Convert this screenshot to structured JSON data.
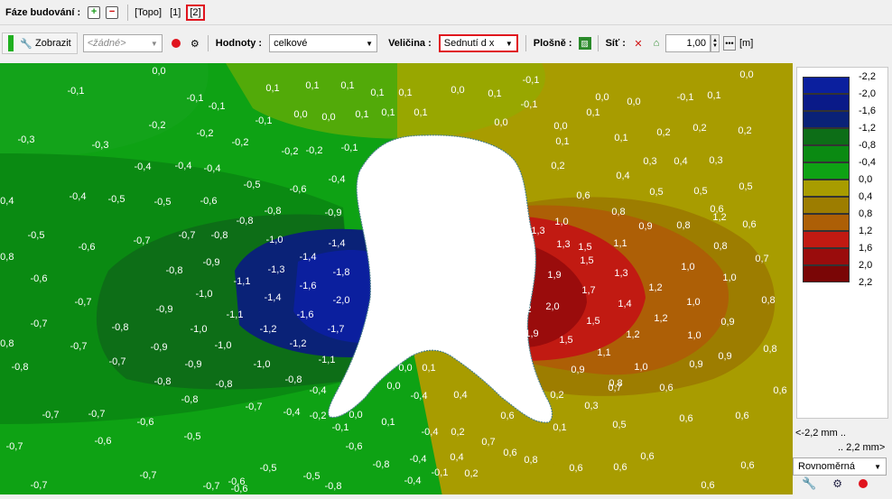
{
  "phase_bar": {
    "label": "Fáze budování :",
    "phases": [
      "[Topo]",
      "[1]",
      "[2]"
    ],
    "selected_index": 2
  },
  "toolbar": {
    "show_label": "Zobrazit",
    "none_combo": "<žádné>",
    "values_label": "Hodnoty :",
    "values_combo": "celkové",
    "quantity_label": "Veličina :",
    "quantity_combo": "Sednutí d x",
    "area_label": "Plošně :",
    "grid_label": "Síť :",
    "grid_value": "1,00",
    "grid_unit": "[m]"
  },
  "legend": {
    "colors": [
      "#0b1f9e",
      "#0a1a88",
      "#0a2277",
      "#0d6e17",
      "#0a8a12",
      "#0ea214",
      "#a89c00",
      "#9d7d00",
      "#ad5f06",
      "#c11a12",
      "#9a0c0c",
      "#7a0606"
    ],
    "labels": [
      "-2,2",
      "-2,0",
      "-1,6",
      "-1,2",
      "-0,8",
      "-0,4",
      "0,0",
      "0,4",
      "0,8",
      "1,2",
      "1,6",
      "2,0",
      "2,2"
    ],
    "range_min": "<-2,2 mm ..",
    "range_max": ".. 2,2 mm>",
    "scale_mode": "Rovnoměrná"
  },
  "plot_labels": [
    [
      "0,0",
      176,
      82
    ],
    [
      "-0,1",
      84,
      104
    ],
    [
      "-0,1",
      216,
      112
    ],
    [
      "0,1",
      302,
      101
    ],
    [
      "0,1",
      346,
      98
    ],
    [
      "0,1",
      385,
      98
    ],
    [
      "0,1",
      418,
      106
    ],
    [
      "0,1",
      449,
      106
    ],
    [
      "0,0",
      507,
      103
    ],
    [
      "0,1",
      548,
      107
    ],
    [
      "-0,1",
      588,
      92
    ],
    [
      "0,0",
      667,
      111
    ],
    [
      "0,0",
      702,
      116
    ],
    [
      "-0,1",
      759,
      111
    ],
    [
      "0,0",
      827,
      86
    ],
    [
      "-0,1",
      240,
      121
    ],
    [
      "-0,2",
      174,
      142
    ],
    [
      "-0,1",
      292,
      137
    ],
    [
      "0,0",
      333,
      130
    ],
    [
      "0,0",
      364,
      133
    ],
    [
      "0,1",
      401,
      130
    ],
    [
      "0,1",
      430,
      128
    ],
    [
      "0,1",
      466,
      128
    ],
    [
      "0,0",
      555,
      139
    ],
    [
      "-0,1",
      586,
      119
    ],
    [
      "0,1",
      657,
      128
    ],
    [
      "0,1",
      791,
      109
    ],
    [
      "0,0",
      621,
      143
    ],
    [
      "0,1",
      688,
      156
    ],
    [
      "0,2",
      735,
      150
    ],
    [
      "0,2",
      775,
      145
    ],
    [
      "0,2",
      825,
      148
    ],
    [
      "-0,3",
      29,
      158
    ],
    [
      "-0,3",
      111,
      164
    ],
    [
      "-0,2",
      227,
      151
    ],
    [
      "-0,2",
      266,
      161
    ],
    [
      "-0,2",
      321,
      171
    ],
    [
      "-0,2",
      348,
      170
    ],
    [
      "-0,1",
      387,
      167
    ],
    [
      "0,1",
      623,
      160
    ],
    [
      "-0,4",
      158,
      188
    ],
    [
      "-0,4",
      203,
      187
    ],
    [
      "-0,4",
      235,
      190
    ],
    [
      "0,2",
      618,
      187
    ],
    [
      "0,3",
      720,
      182
    ],
    [
      "0,4",
      754,
      182
    ],
    [
      "0,3",
      793,
      181
    ],
    [
      "-0,5",
      279,
      208
    ],
    [
      "-0,6",
      330,
      213
    ],
    [
      "-0,4",
      373,
      202
    ],
    [
      "0,4",
      690,
      198
    ],
    [
      "0,5",
      727,
      216
    ],
    [
      "0,5",
      776,
      215
    ],
    [
      "0,5",
      826,
      210
    ],
    [
      "-0,4",
      6,
      226
    ],
    [
      "-0,4",
      86,
      221
    ],
    [
      "-0,5",
      129,
      224
    ],
    [
      "-0,5",
      180,
      227
    ],
    [
      "-0,6",
      231,
      226
    ],
    [
      "0,6",
      646,
      220
    ],
    [
      "0,8",
      685,
      238
    ],
    [
      "0,6",
      794,
      235
    ],
    [
      "-0,8",
      302,
      237
    ],
    [
      "-0,9",
      369,
      239
    ],
    [
      "-0,8",
      271,
      248
    ],
    [
      "1,0",
      622,
      249
    ],
    [
      "0,9",
      715,
      254
    ],
    [
      "0,8",
      757,
      253
    ],
    [
      "1,2",
      797,
      244
    ],
    [
      "0,6",
      830,
      252
    ],
    [
      "-0,5",
      40,
      264
    ],
    [
      "-0,6",
      96,
      277
    ],
    [
      "-0,7",
      157,
      270
    ],
    [
      "-0,7",
      207,
      264
    ],
    [
      "-0,8",
      243,
      264
    ],
    [
      "-1,0",
      304,
      269
    ],
    [
      "-1,4",
      373,
      273
    ],
    [
      "1,3",
      596,
      259
    ],
    [
      "1,3",
      624,
      274
    ],
    [
      "1,5",
      648,
      277
    ],
    [
      "1,1",
      687,
      273
    ],
    [
      "0,8",
      798,
      276
    ],
    [
      "-0,8",
      6,
      288
    ],
    [
      "-0,9",
      234,
      294
    ],
    [
      "-1,4",
      341,
      288
    ],
    [
      "-1,8",
      378,
      305
    ],
    [
      "1,5",
      650,
      292
    ],
    [
      "1,0",
      762,
      299
    ],
    [
      "0,7",
      844,
      290
    ],
    [
      "-0,6",
      43,
      312
    ],
    [
      "-0,8",
      193,
      303
    ],
    [
      "-1,3",
      306,
      302
    ],
    [
      "-1,6",
      341,
      320
    ],
    [
      "-2,0",
      378,
      336
    ],
    [
      "1,9",
      614,
      308
    ],
    [
      "1,3",
      688,
      306
    ],
    [
      "1,2",
      726,
      322
    ],
    [
      "1,0",
      808,
      311
    ],
    [
      "-1,1",
      268,
      315
    ],
    [
      "-1,4",
      302,
      333
    ],
    [
      "-1,0",
      226,
      329
    ],
    [
      "-1,6",
      338,
      352
    ],
    [
      "-0,7",
      92,
      338
    ],
    [
      "-0,9",
      182,
      346
    ],
    [
      "2,2",
      583,
      318
    ],
    [
      "1,7",
      652,
      325
    ],
    [
      "1,4",
      692,
      340
    ],
    [
      "1,0",
      768,
      338
    ],
    [
      "0,8",
      851,
      336
    ],
    [
      "-0,8",
      133,
      366
    ],
    [
      "-1,1",
      260,
      352
    ],
    [
      "-1,2",
      297,
      368
    ],
    [
      "-1,7",
      372,
      368
    ],
    [
      "-1,0",
      220,
      368
    ],
    [
      "2,2",
      581,
      346
    ],
    [
      "2,0",
      612,
      343
    ],
    [
      "1,2",
      732,
      356
    ],
    [
      "1,5",
      657,
      359
    ],
    [
      "0,9",
      806,
      360
    ],
    [
      "-0,7",
      43,
      362
    ],
    [
      "-0,7",
      87,
      387
    ],
    [
      "-0,9",
      176,
      388
    ],
    [
      "-1,0",
      247,
      386
    ],
    [
      "-1,2",
      330,
      384
    ],
    [
      "1,9",
      589,
      373
    ],
    [
      "1,5",
      627,
      380
    ],
    [
      "1,2",
      701,
      374
    ],
    [
      "1,0",
      769,
      375
    ],
    [
      "0,8",
      853,
      390
    ],
    [
      "-0,8",
      6,
      384
    ],
    [
      "-0,8",
      22,
      410
    ],
    [
      "-0,7",
      130,
      404
    ],
    [
      "-0,9",
      214,
      407
    ],
    [
      "-1,0",
      290,
      407
    ],
    [
      "-1,1",
      362,
      402
    ],
    [
      "1,1",
      669,
      394
    ],
    [
      "1,0",
      710,
      410
    ],
    [
      "0,9",
      771,
      407
    ],
    [
      "0,9",
      803,
      398
    ],
    [
      "0,9",
      640,
      413
    ],
    [
      "0,8",
      682,
      428
    ],
    [
      "-0,8",
      180,
      426
    ],
    [
      "-0,8",
      248,
      429
    ],
    [
      "-0,8",
      325,
      424
    ],
    [
      "0,0",
      449,
      411
    ],
    [
      "0,1",
      475,
      411
    ],
    [
      "0,7",
      681,
      433
    ],
    [
      "0,6",
      738,
      433
    ],
    [
      "0,6",
      864,
      436
    ],
    [
      "-0,7",
      107,
      462
    ],
    [
      "-0,8",
      210,
      446
    ],
    [
      "-0,7",
      281,
      454
    ],
    [
      "-0,4",
      352,
      436
    ],
    [
      "-0,4",
      464,
      442
    ],
    [
      "0,4",
      510,
      441
    ],
    [
      "0,2",
      617,
      441
    ],
    [
      "0,3",
      655,
      453
    ],
    [
      "-0,7",
      56,
      463
    ],
    [
      "-0,6",
      161,
      471
    ],
    [
      "-0,4",
      323,
      460
    ],
    [
      "-0,2",
      352,
      464
    ],
    [
      "0,0",
      394,
      463
    ],
    [
      "0,6",
      562,
      464
    ],
    [
      "0,5",
      686,
      474
    ],
    [
      "0,6",
      760,
      467
    ],
    [
      "0,6",
      822,
      464
    ],
    [
      "0,1",
      430,
      471
    ],
    [
      "0,0",
      436,
      431
    ],
    [
      "-0,1",
      377,
      477
    ],
    [
      "-0,4",
      476,
      482
    ],
    [
      "0,2",
      507,
      482
    ],
    [
      "0,1",
      620,
      477
    ],
    [
      "0,6",
      565,
      505
    ],
    [
      "0,6",
      717,
      509
    ],
    [
      "-0,5",
      213,
      487
    ],
    [
      "-0,7",
      16,
      498
    ],
    [
      "-0,6",
      114,
      492
    ],
    [
      "-0,6",
      392,
      498
    ],
    [
      "0,7",
      541,
      493
    ],
    [
      "-0,4",
      463,
      512
    ],
    [
      "0,4",
      506,
      510
    ],
    [
      "0,8",
      588,
      513
    ],
    [
      "0,6",
      638,
      522
    ],
    [
      "0,6",
      687,
      521
    ],
    [
      "0,6",
      828,
      519
    ],
    [
      "-0,7",
      164,
      530
    ],
    [
      "-0,6",
      262,
      537
    ],
    [
      "-0,5",
      297,
      522
    ],
    [
      "-0,8",
      422,
      518
    ],
    [
      "-0,5",
      345,
      531
    ],
    [
      "-0,1",
      487,
      527
    ],
    [
      "0,2",
      522,
      528
    ],
    [
      "-0,7",
      43,
      541
    ],
    [
      "-0,7",
      234,
      542
    ],
    [
      "-0,6",
      265,
      545
    ],
    [
      "-0,8",
      369,
      542
    ],
    [
      "-0,4",
      457,
      536
    ],
    [
      "0,6",
      784,
      541
    ]
  ]
}
